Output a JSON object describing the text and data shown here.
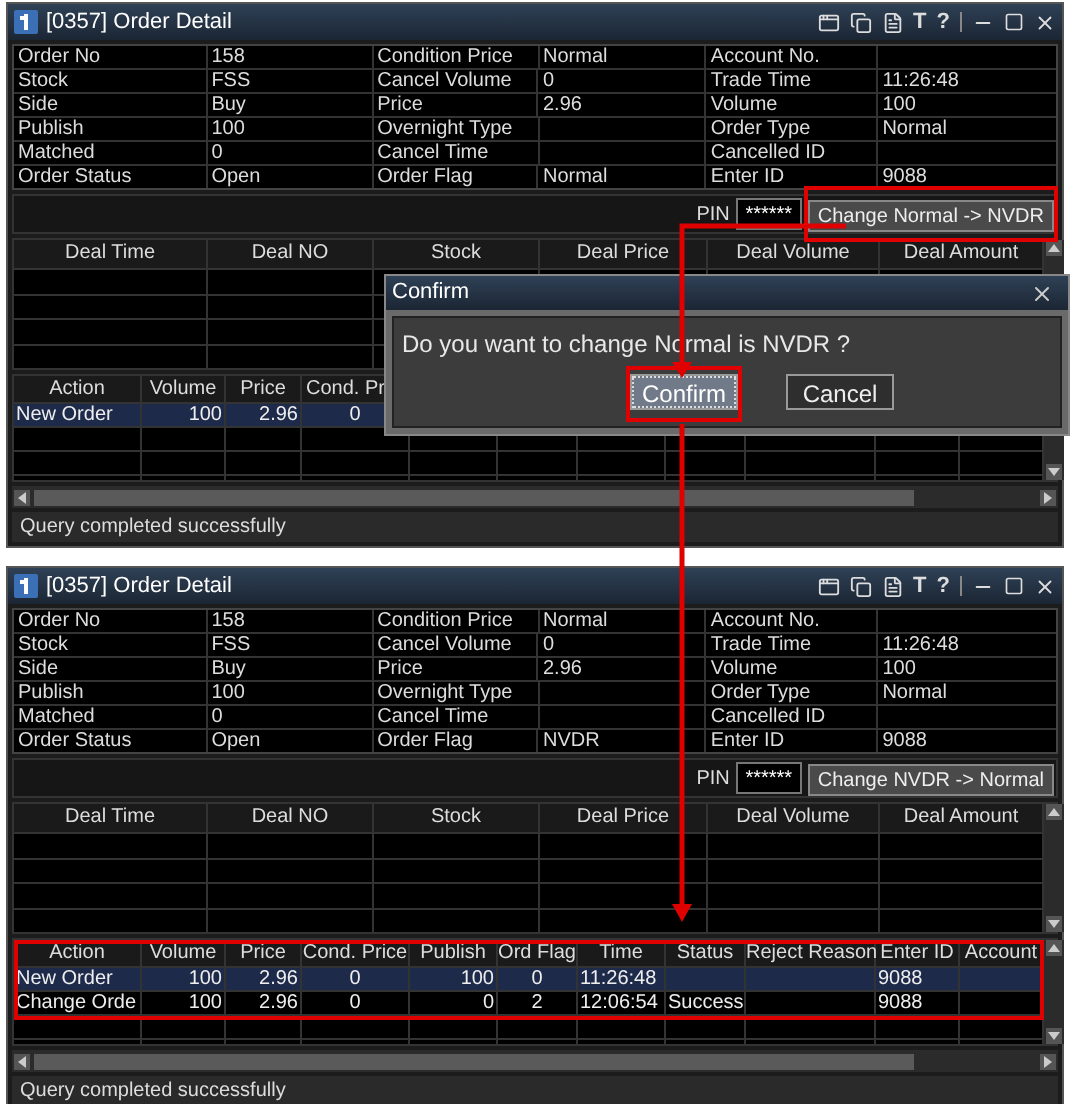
{
  "windows": [
    {
      "title": "[0357] Order Detail",
      "tool_glyphs": [
        "T",
        "?"
      ],
      "fields": [
        [
          {
            "label": "Order No",
            "value": "158"
          },
          {
            "label": "Condition Price",
            "value": "Normal"
          },
          {
            "label": "Account No."
          }
        ],
        [
          {
            "label": "Stock",
            "value": "FSS"
          },
          {
            "label": "Cancel Volume",
            "value": "0"
          },
          {
            "label": "Trade Time",
            "value": "11:26:48"
          }
        ],
        [
          {
            "label": "Side",
            "value": "Buy"
          },
          {
            "label": "Price",
            "value": "2.96"
          },
          {
            "label": "Volume",
            "value": "100"
          }
        ],
        [
          {
            "label": "Publish",
            "value": "100"
          },
          {
            "label": "Overnight Type"
          },
          {
            "label": "Order Type",
            "value": "Normal"
          }
        ],
        [
          {
            "label": "Matched",
            "value": "0"
          },
          {
            "label": "Cancel Time"
          },
          {
            "label": "Cancelled ID"
          }
        ],
        [
          {
            "label": "Order Status",
            "value": "Open"
          },
          {
            "label": "Order Flag",
            "value": "Normal"
          },
          {
            "label": "Enter ID",
            "value": "9088"
          }
        ]
      ],
      "pin": {
        "label": "PIN",
        "value": "******"
      },
      "change_button": {
        "label": "Change Normal -> NVDR",
        "highlighted": true
      },
      "deal_columns": [
        "Deal Time",
        "Deal NO",
        "Stock",
        "Deal Price",
        "Deal Volume",
        "Deal Amount"
      ],
      "order_table": {
        "highlighted": false,
        "columns": [
          "Action",
          "Volume",
          "Price",
          "Cond. Pr"
        ],
        "rows": [
          {
            "selected": true,
            "action": "New Order",
            "volume": "100",
            "price": "2.96",
            "cond_price": "0"
          }
        ]
      },
      "status": "Query completed successfully"
    },
    {
      "title": "[0357] Order Detail",
      "tool_glyphs": [
        "T",
        "?"
      ],
      "fields": [
        [
          {
            "label": "Order No",
            "value": "158"
          },
          {
            "label": "Condition Price",
            "value": "Normal"
          },
          {
            "label": "Account No."
          }
        ],
        [
          {
            "label": "Stock",
            "value": "FSS"
          },
          {
            "label": "Cancel Volume",
            "value": "0"
          },
          {
            "label": "Trade Time",
            "value": "11:26:48"
          }
        ],
        [
          {
            "label": "Side",
            "value": "Buy"
          },
          {
            "label": "Price",
            "value": "2.96"
          },
          {
            "label": "Volume",
            "value": "100"
          }
        ],
        [
          {
            "label": "Publish",
            "value": "100"
          },
          {
            "label": "Overnight Type"
          },
          {
            "label": "Order Type",
            "value": "Normal"
          }
        ],
        [
          {
            "label": "Matched",
            "value": "0"
          },
          {
            "label": "Cancel Time"
          },
          {
            "label": "Cancelled ID"
          }
        ],
        [
          {
            "label": "Order Status",
            "value": "Open"
          },
          {
            "label": "Order Flag",
            "value": "NVDR"
          },
          {
            "label": "Enter ID",
            "value": "9088"
          }
        ]
      ],
      "pin": {
        "label": "PIN",
        "value": "******"
      },
      "change_button": {
        "label": "Change NVDR -> Normal",
        "highlighted": false
      },
      "deal_columns": [
        "Deal Time",
        "Deal NO",
        "Stock",
        "Deal Price",
        "Deal Volume",
        "Deal Amount"
      ],
      "order_table": {
        "highlighted": true,
        "columns": [
          "Action",
          "Volume",
          "Price",
          "Cond. Price",
          "Publish",
          "Ord Flag",
          "Time",
          "Status",
          "Reject Reason",
          "Enter ID",
          "Account"
        ],
        "rows": [
          {
            "selected": true,
            "action": "New Order",
            "volume": "100",
            "price": "2.96",
            "cond_price": "0",
            "publish": "100",
            "ord_flag": "0",
            "time": "11:26:48",
            "enter_id": "9088"
          },
          {
            "selected": false,
            "action": "Change Orde",
            "volume": "100",
            "price": "2.96",
            "cond_price": "0",
            "publish": "0",
            "ord_flag": "2",
            "time": "12:06:54",
            "status": "Success",
            "enter_id": "9088"
          }
        ]
      },
      "status": "Query completed successfully"
    }
  ],
  "dialog": {
    "title": "Confirm",
    "message": "Do you want to change Normal is NVDR ?",
    "buttons": [
      {
        "label": "Confirm",
        "focused": true,
        "highlighted": true
      },
      {
        "label": "Cancel",
        "focused": false,
        "highlighted": false
      }
    ]
  }
}
